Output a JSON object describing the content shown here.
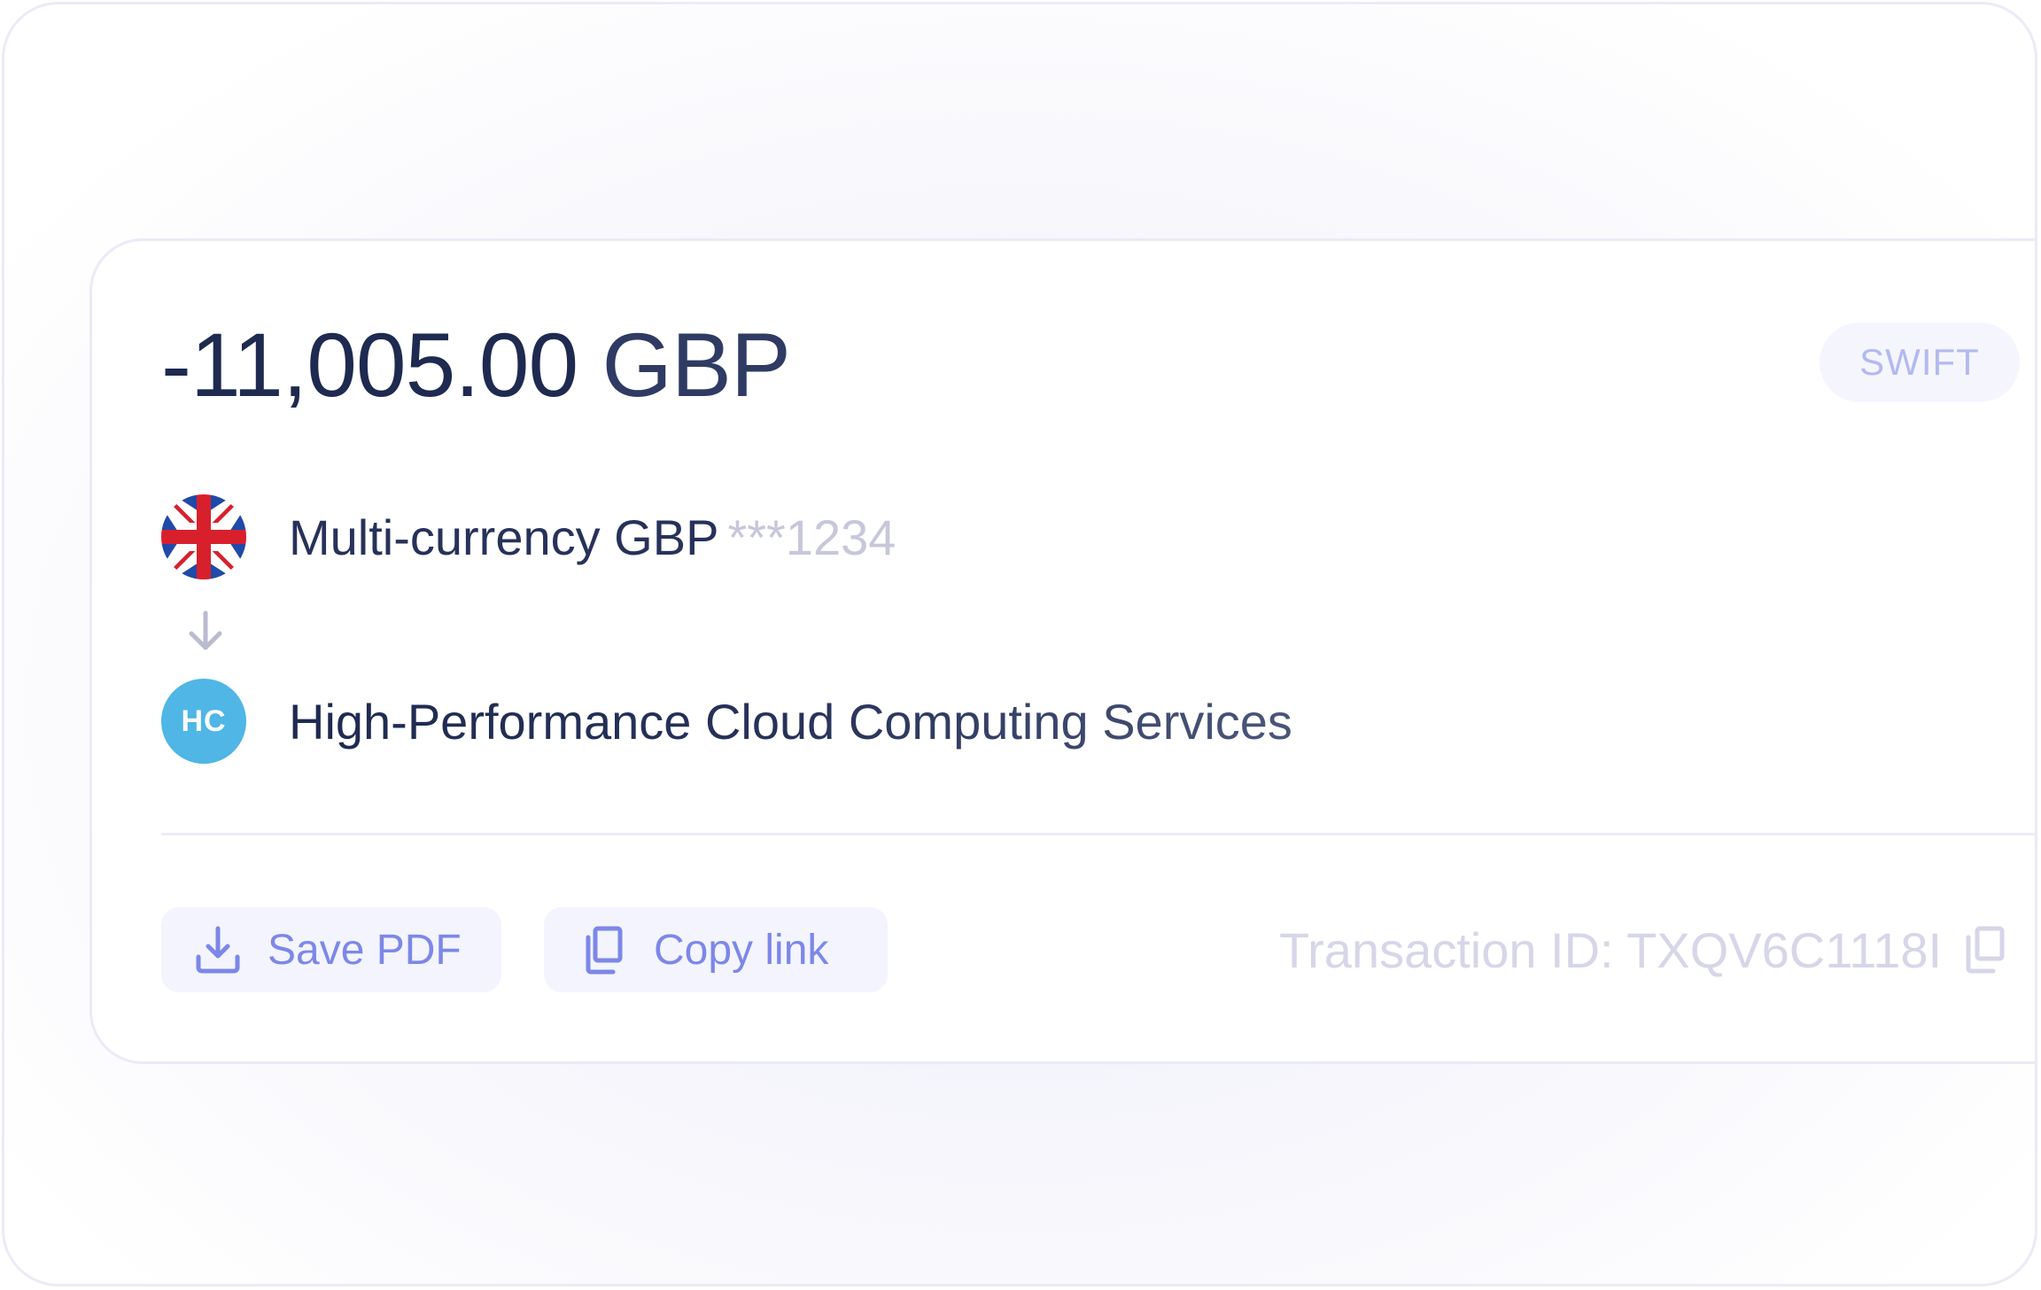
{
  "transaction": {
    "amount": "-11,005.00",
    "currency": "GBP",
    "method_badge": "SWIFT"
  },
  "from": {
    "flag_icon": "uk-flag-icon",
    "account_name": "Multi-currency GBP",
    "account_masked": "***1234"
  },
  "to": {
    "avatar_initials": "HC",
    "avatar_color": "#4fb6e6",
    "name": "High-Performance Cloud Computing Services"
  },
  "actions": {
    "save_pdf_label": "Save PDF",
    "save_pdf_icon": "download-icon",
    "copy_link_label": "Copy link",
    "copy_link_icon": "copy-icon"
  },
  "transaction_id": {
    "label": "Transaction ID: TXQV6C1118I",
    "copy_icon": "copy-icon"
  },
  "colors": {
    "primary_text": "#1e2a4f",
    "accent": "#7c87e8",
    "muted": "#d6d6e8"
  }
}
